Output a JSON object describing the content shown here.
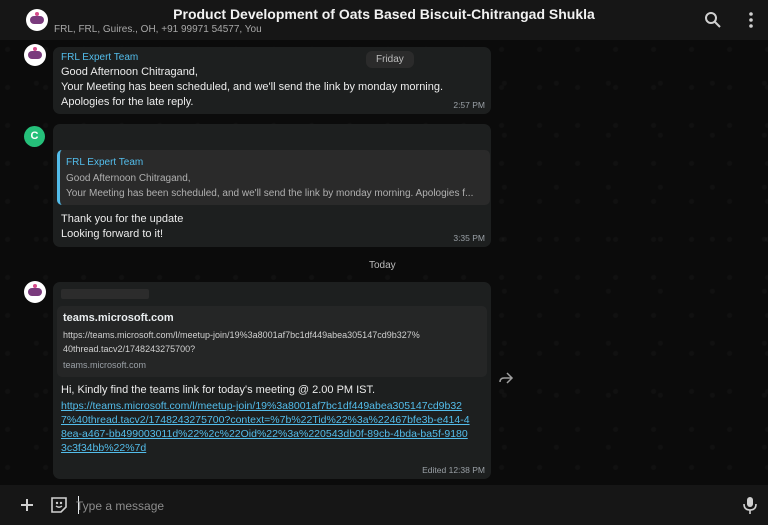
{
  "header": {
    "title": "Product Development of Oats Based Biscuit-Chitrangad Shukla",
    "participants": "FRL, FRL, Guires., OH, +91 99971 54577, You"
  },
  "day_labels": {
    "friday": "Friday",
    "today": "Today"
  },
  "messages": {
    "m1": {
      "sender": "FRL Expert Team",
      "text": "Good Afternoon Chitragand,\nYour Meeting has been scheduled, and we'll send the link by monday morning.\nApologies for the late reply.",
      "time": "2:57 PM"
    },
    "m2": {
      "avatar_letter": "C",
      "quote_sender": "FRL Expert Team",
      "quote_line1": "Good Afternoon Chitragand,",
      "quote_line2": "Your Meeting has been scheduled, and we'll send the link by monday morning. Apologies f...",
      "text": "Thank you for the update\nLooking forward to it!",
      "time": "3:35 PM"
    },
    "m3": {
      "preview_title": "teams.microsoft.com",
      "preview_url": "https://teams.microsoft.com/l/meetup-join/19%3a8001af7bc1df449abea305147cd9b327%40thread.tacv2/1748243275700?",
      "preview_domain": "teams.microsoft.com",
      "text": "Hi, Kindly find the teams link for today's meeting @ 2.00 PM IST.",
      "link": "https://teams.microsoft.com/l/meetup-join/19%3a8001af7bc1df449abea305147cd9b327%40thread.tacv2/1748243275700?context=%7b%22Tid%22%3a%22467bfe3b-e414-48ea-a467-bb499003011d%22%2c%22Oid%22%3a%220543db0f-89cb-4bda-ba5f-91803c3f34bb%22%7d",
      "time": "Edited 12:38 PM"
    }
  },
  "composer": {
    "placeholder": "Type a message"
  },
  "colors": {
    "link": "#53bdeb",
    "bubble": "#1d1f1f",
    "header": "#161616"
  }
}
